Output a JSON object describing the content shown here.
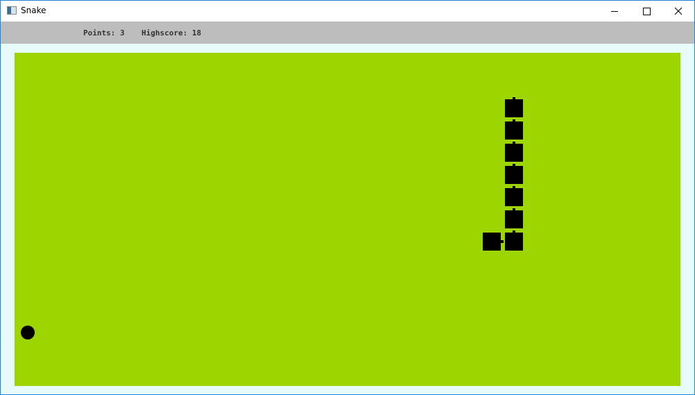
{
  "window": {
    "title": "Snake",
    "app_icon": "app-window-icon",
    "controls": [
      "minimize-icon",
      "maximize-icon",
      "close-icon"
    ]
  },
  "status": {
    "points_label": "Points: 3",
    "highscore_label": "Highscore: 18",
    "background": "#bdbdbd"
  },
  "board": {
    "background": "#9dd500",
    "snake_color": "#000000",
    "snake_length": 8,
    "food_color": "#000000"
  }
}
